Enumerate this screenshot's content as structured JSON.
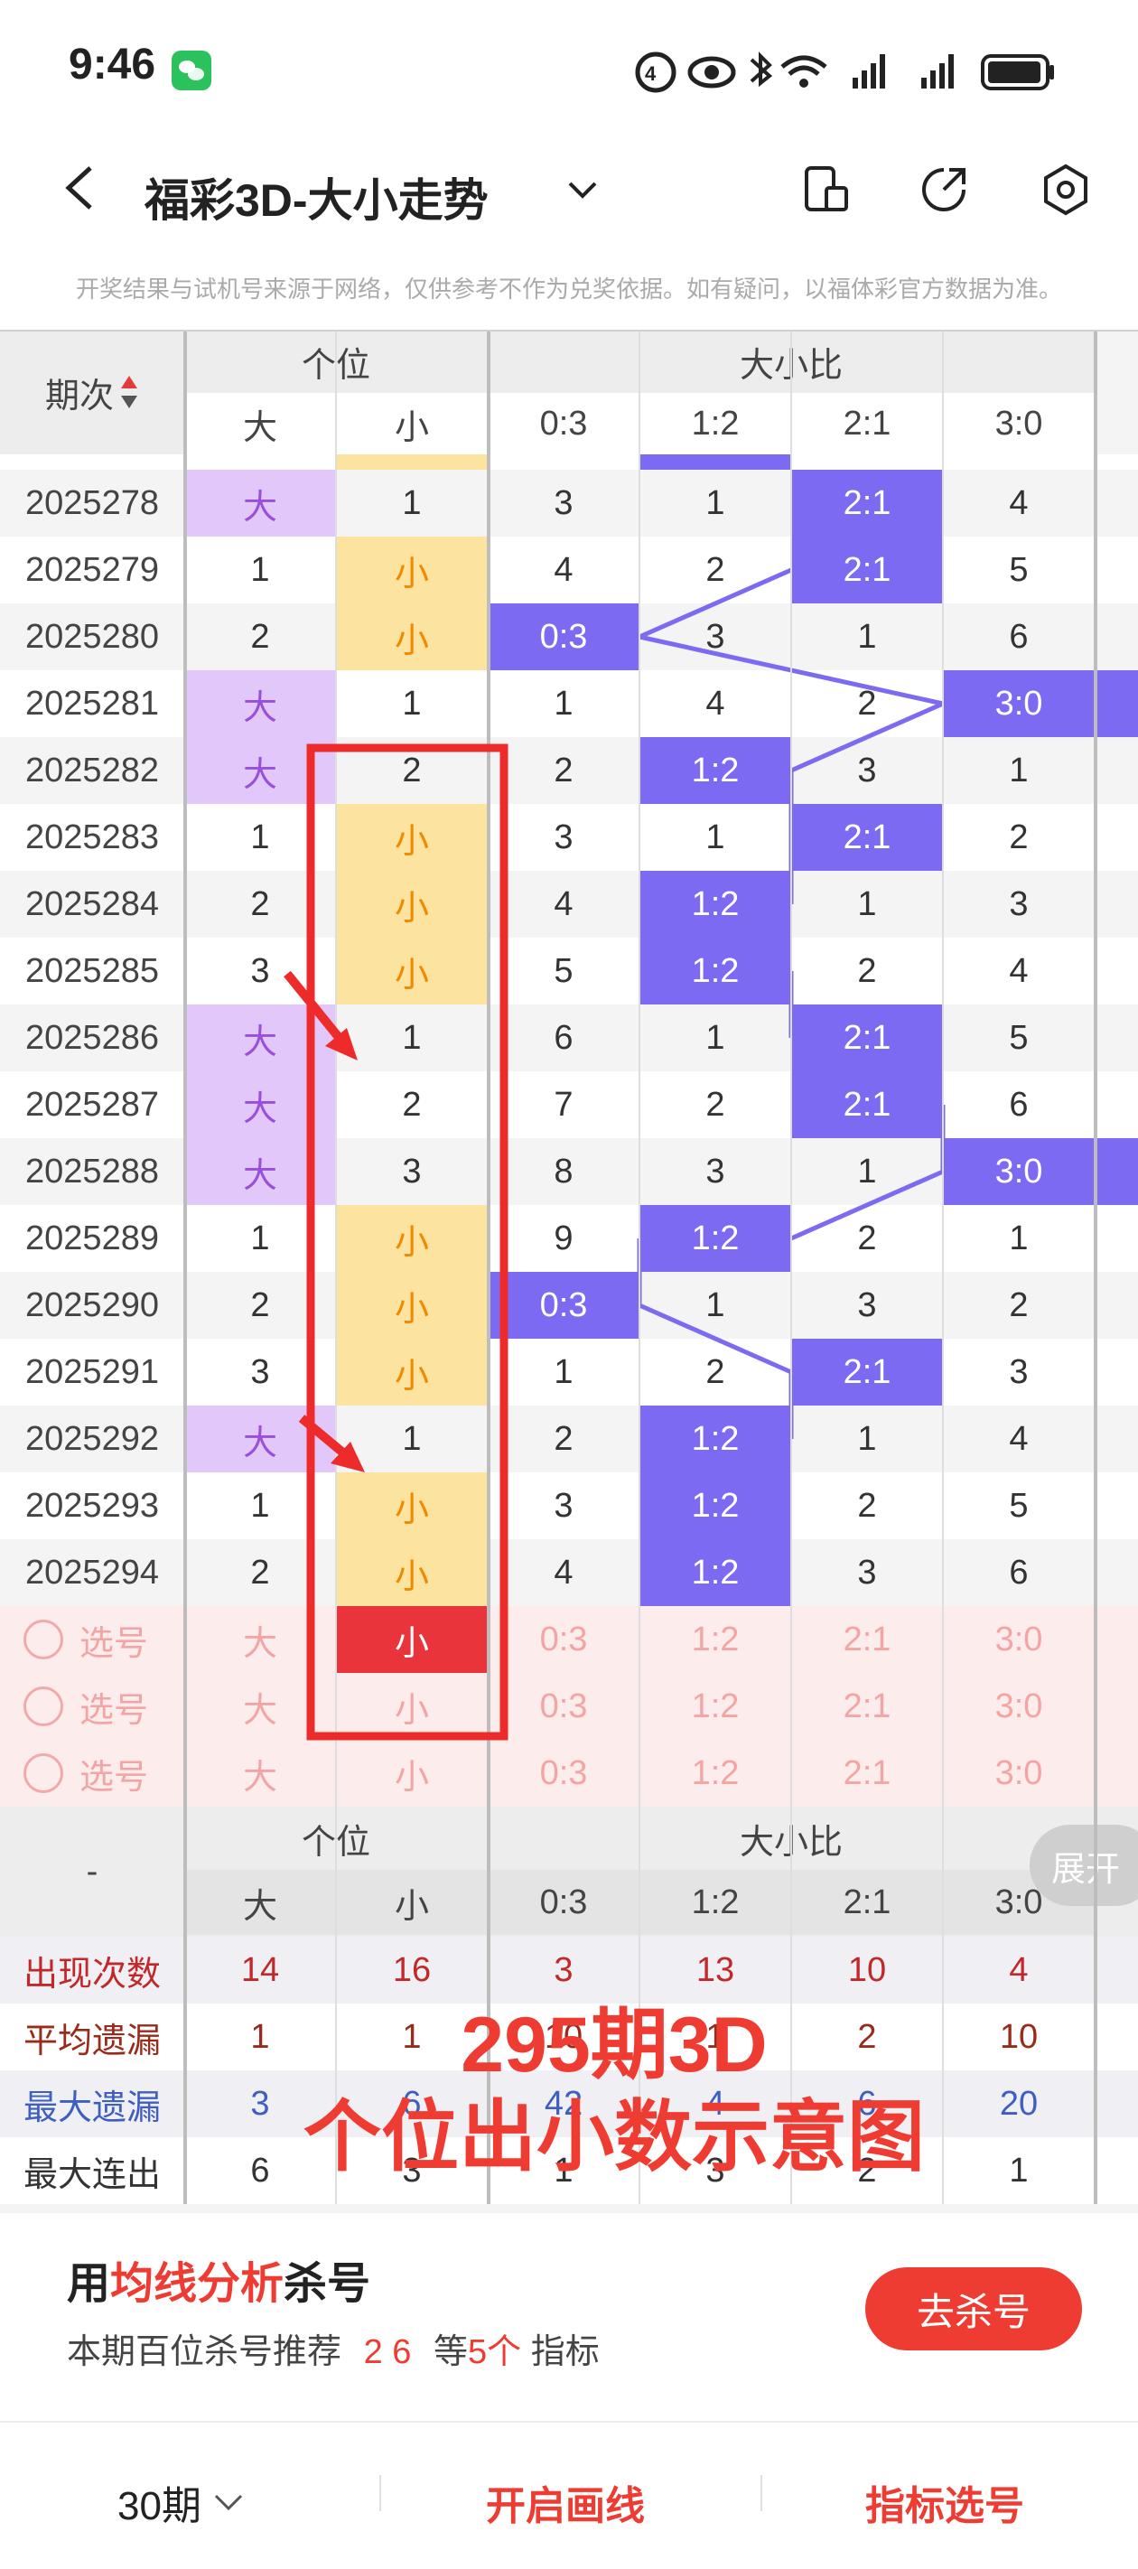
{
  "status_bar": {
    "time": "9:46",
    "icons": [
      "wechat-icon",
      "hd-icon",
      "eye-icon",
      "bluetooth-icon",
      "wifi-icon",
      "signal-icon",
      "signal-icon",
      "battery-icon"
    ]
  },
  "nav": {
    "title": "福彩3D-大小走势"
  },
  "disclaimer": "开奖结果与试机号来源于网络，仅供参考不作为兑奖依据。如有疑问，以福体彩官方数据为准。",
  "table": {
    "period_header": "期次",
    "group1": "个位",
    "group2": "大小比",
    "sub1": [
      "大",
      "小"
    ],
    "sub2": [
      "0:3",
      "1:2",
      "2:1",
      "3:0"
    ],
    "rows": [
      {
        "period": "2025278",
        "big": "大",
        "small": "1",
        "ratio": [
          "3",
          "1",
          "2:1",
          "4"
        ],
        "big_hit": true,
        "small_hit": false,
        "hit": 2
      },
      {
        "period": "2025279",
        "big": "1",
        "small": "小",
        "ratio": [
          "4",
          "2",
          "2:1",
          "5"
        ],
        "big_hit": false,
        "small_hit": true,
        "hit": 2
      },
      {
        "period": "2025280",
        "big": "2",
        "small": "小",
        "ratio": [
          "0:3",
          "3",
          "1",
          "6"
        ],
        "big_hit": false,
        "small_hit": true,
        "hit": 0
      },
      {
        "period": "2025281",
        "big": "大",
        "small": "1",
        "ratio": [
          "1",
          "4",
          "2",
          "3:0"
        ],
        "big_hit": true,
        "small_hit": false,
        "hit": 3
      },
      {
        "period": "2025282",
        "big": "大",
        "small": "2",
        "ratio": [
          "2",
          "1:2",
          "3",
          "1"
        ],
        "big_hit": true,
        "small_hit": false,
        "hit": 1
      },
      {
        "period": "2025283",
        "big": "1",
        "small": "小",
        "ratio": [
          "3",
          "1",
          "2:1",
          "2"
        ],
        "big_hit": false,
        "small_hit": true,
        "hit": 2
      },
      {
        "period": "2025284",
        "big": "2",
        "small": "小",
        "ratio": [
          "4",
          "1:2",
          "1",
          "3"
        ],
        "big_hit": false,
        "small_hit": true,
        "hit": 1
      },
      {
        "period": "2025285",
        "big": "3",
        "small": "小",
        "ratio": [
          "5",
          "1:2",
          "2",
          "4"
        ],
        "big_hit": false,
        "small_hit": true,
        "hit": 1
      },
      {
        "period": "2025286",
        "big": "大",
        "small": "1",
        "ratio": [
          "6",
          "1",
          "2:1",
          "5"
        ],
        "big_hit": true,
        "small_hit": false,
        "hit": 2
      },
      {
        "period": "2025287",
        "big": "大",
        "small": "2",
        "ratio": [
          "7",
          "2",
          "2:1",
          "6"
        ],
        "big_hit": true,
        "small_hit": false,
        "hit": 2
      },
      {
        "period": "2025288",
        "big": "大",
        "small": "3",
        "ratio": [
          "8",
          "3",
          "1",
          "3:0"
        ],
        "big_hit": true,
        "small_hit": false,
        "hit": 3
      },
      {
        "period": "2025289",
        "big": "1",
        "small": "小",
        "ratio": [
          "9",
          "1:2",
          "2",
          "1"
        ],
        "big_hit": false,
        "small_hit": true,
        "hit": 1
      },
      {
        "period": "2025290",
        "big": "2",
        "small": "小",
        "ratio": [
          "0:3",
          "1",
          "3",
          "2"
        ],
        "big_hit": false,
        "small_hit": true,
        "hit": 0
      },
      {
        "period": "2025291",
        "big": "3",
        "small": "小",
        "ratio": [
          "1",
          "2",
          "2:1",
          "3"
        ],
        "big_hit": false,
        "small_hit": true,
        "hit": 2
      },
      {
        "period": "2025292",
        "big": "大",
        "small": "1",
        "ratio": [
          "2",
          "1:2",
          "1",
          "4"
        ],
        "big_hit": true,
        "small_hit": false,
        "hit": 1
      },
      {
        "period": "2025293",
        "big": "1",
        "small": "小",
        "ratio": [
          "3",
          "1:2",
          "2",
          "5"
        ],
        "big_hit": false,
        "small_hit": true,
        "hit": 1
      },
      {
        "period": "2025294",
        "big": "2",
        "small": "小",
        "ratio": [
          "4",
          "1:2",
          "3",
          "6"
        ],
        "big_hit": false,
        "small_hit": true,
        "hit": 1
      }
    ],
    "select_rows": [
      {
        "label": "选号",
        "big": "大",
        "small": "小",
        "ratio": [
          "0:3",
          "1:2",
          "2:1",
          "3:0"
        ],
        "small_selected": true
      },
      {
        "label": "选号",
        "big": "大",
        "small": "小",
        "ratio": [
          "0:3",
          "1:2",
          "2:1",
          "3:0"
        ],
        "small_selected": false
      },
      {
        "label": "选号",
        "big": "大",
        "small": "小",
        "ratio": [
          "0:3",
          "1:2",
          "2:1",
          "3:0"
        ],
        "small_selected": false
      }
    ],
    "stats_header_left": "-",
    "expand_label": "展开",
    "stats": [
      {
        "label": "出现次数",
        "values": [
          "14",
          "16",
          "3",
          "13",
          "10",
          "4"
        ],
        "color": "#c0282a"
      },
      {
        "label": "平均遗漏",
        "values": [
          "1",
          "1",
          "10",
          "1",
          "2",
          "10"
        ],
        "color": "#9a2a1a"
      },
      {
        "label": "最大遗漏",
        "values": [
          "3",
          "6",
          "42",
          "4",
          "6",
          "20"
        ],
        "color": "#3f5fc0"
      },
      {
        "label": "最大连出",
        "values": [
          "6",
          "3",
          "1",
          "3",
          "2",
          "1"
        ],
        "color": "#333333"
      }
    ]
  },
  "overlay": {
    "line1": "295期3D",
    "line2": "个位出小数示意图"
  },
  "card": {
    "prefix": "用",
    "highlight": "均线分析",
    "suffix": "杀号",
    "sub_prefix": "本期百位杀号推荐",
    "sub_nums": "2 6",
    "sub_mid": "等",
    "sub_count": "5个",
    "sub_suffix": "指标",
    "button": "去杀号"
  },
  "footer": {
    "periods": "30期",
    "draw": "开启画线",
    "pick": "指标选号"
  },
  "colors": {
    "accent": "#ef3c33",
    "purple": "#7c6bf2",
    "big_bg": "#e2c8fa",
    "small_bg": "#fde3a0"
  }
}
